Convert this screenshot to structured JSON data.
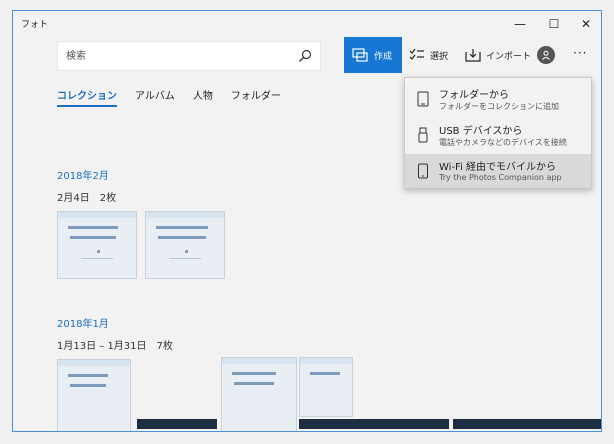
{
  "app": {
    "title": "フォト"
  },
  "window_controls": {
    "minimize": "—",
    "maximize": "☐",
    "close": "✕"
  },
  "search": {
    "placeholder": "検索"
  },
  "toolbar": {
    "create_label": "作成",
    "select_label": "選択",
    "import_label": "インポート",
    "more_label": "···"
  },
  "tabs": [
    {
      "label": "コレクション",
      "active": true
    },
    {
      "label": "アルバム",
      "active": false
    },
    {
      "label": "人物",
      "active": false
    },
    {
      "label": "フォルダー",
      "active": false
    }
  ],
  "groups": [
    {
      "month": "2018年2月",
      "range": "2月4日　2枚"
    },
    {
      "month": "2018年1月",
      "range": "1月13日 – 1月31日　7枚"
    }
  ],
  "import_menu": {
    "items": [
      {
        "title": "フォルダーから",
        "subtitle": "フォルダーをコレクションに追加",
        "icon": "folder-tablet-icon"
      },
      {
        "title": "USB デバイスから",
        "subtitle": "電話やカメラなどのデバイスを接続",
        "icon": "usb-icon"
      },
      {
        "title": "Wi-Fi 経由でモバイルから",
        "subtitle": "Try the Photos Companion app",
        "icon": "phone-icon",
        "highlighted": true
      }
    ]
  },
  "colors": {
    "accent": "#1778d3",
    "link": "#1a6fbf",
    "window_bg": "#f2f2f2"
  }
}
